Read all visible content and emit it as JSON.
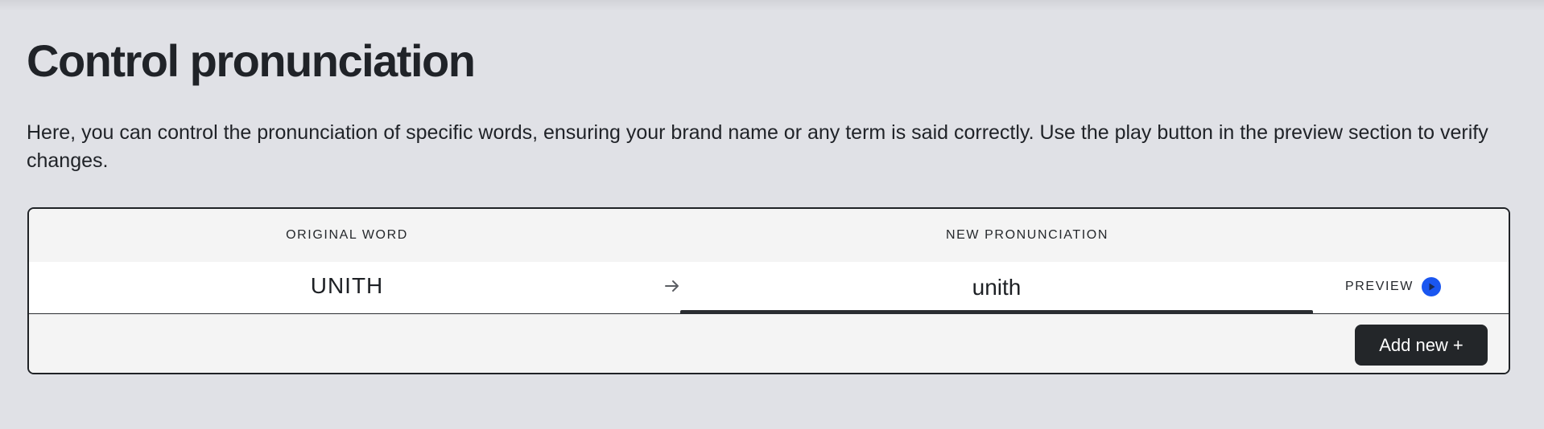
{
  "page": {
    "title": "Control pronunciation",
    "description": "Here, you can control the pronunciation of specific words, ensuring your brand name or any term is said correctly. Use the play button in the preview section to verify changes."
  },
  "table": {
    "headers": {
      "original_word": "ORIGINAL WORD",
      "new_pronunciation": "NEW PRONUNCIATION"
    },
    "rows": [
      {
        "original_word": "UNITH",
        "arrow_icon": "arrow-right-icon",
        "new_pronunciation": "unith",
        "preview_label": "PREVIEW",
        "preview_icon": "play-circle-icon"
      }
    ],
    "add_button_label": "Add new +"
  },
  "colors": {
    "background": "#e0e1e6",
    "card_background": "#f4f4f4",
    "row_background": "#ffffff",
    "accent_play": "#1a56f0",
    "button_dark": "#232629",
    "text": "#202328"
  }
}
